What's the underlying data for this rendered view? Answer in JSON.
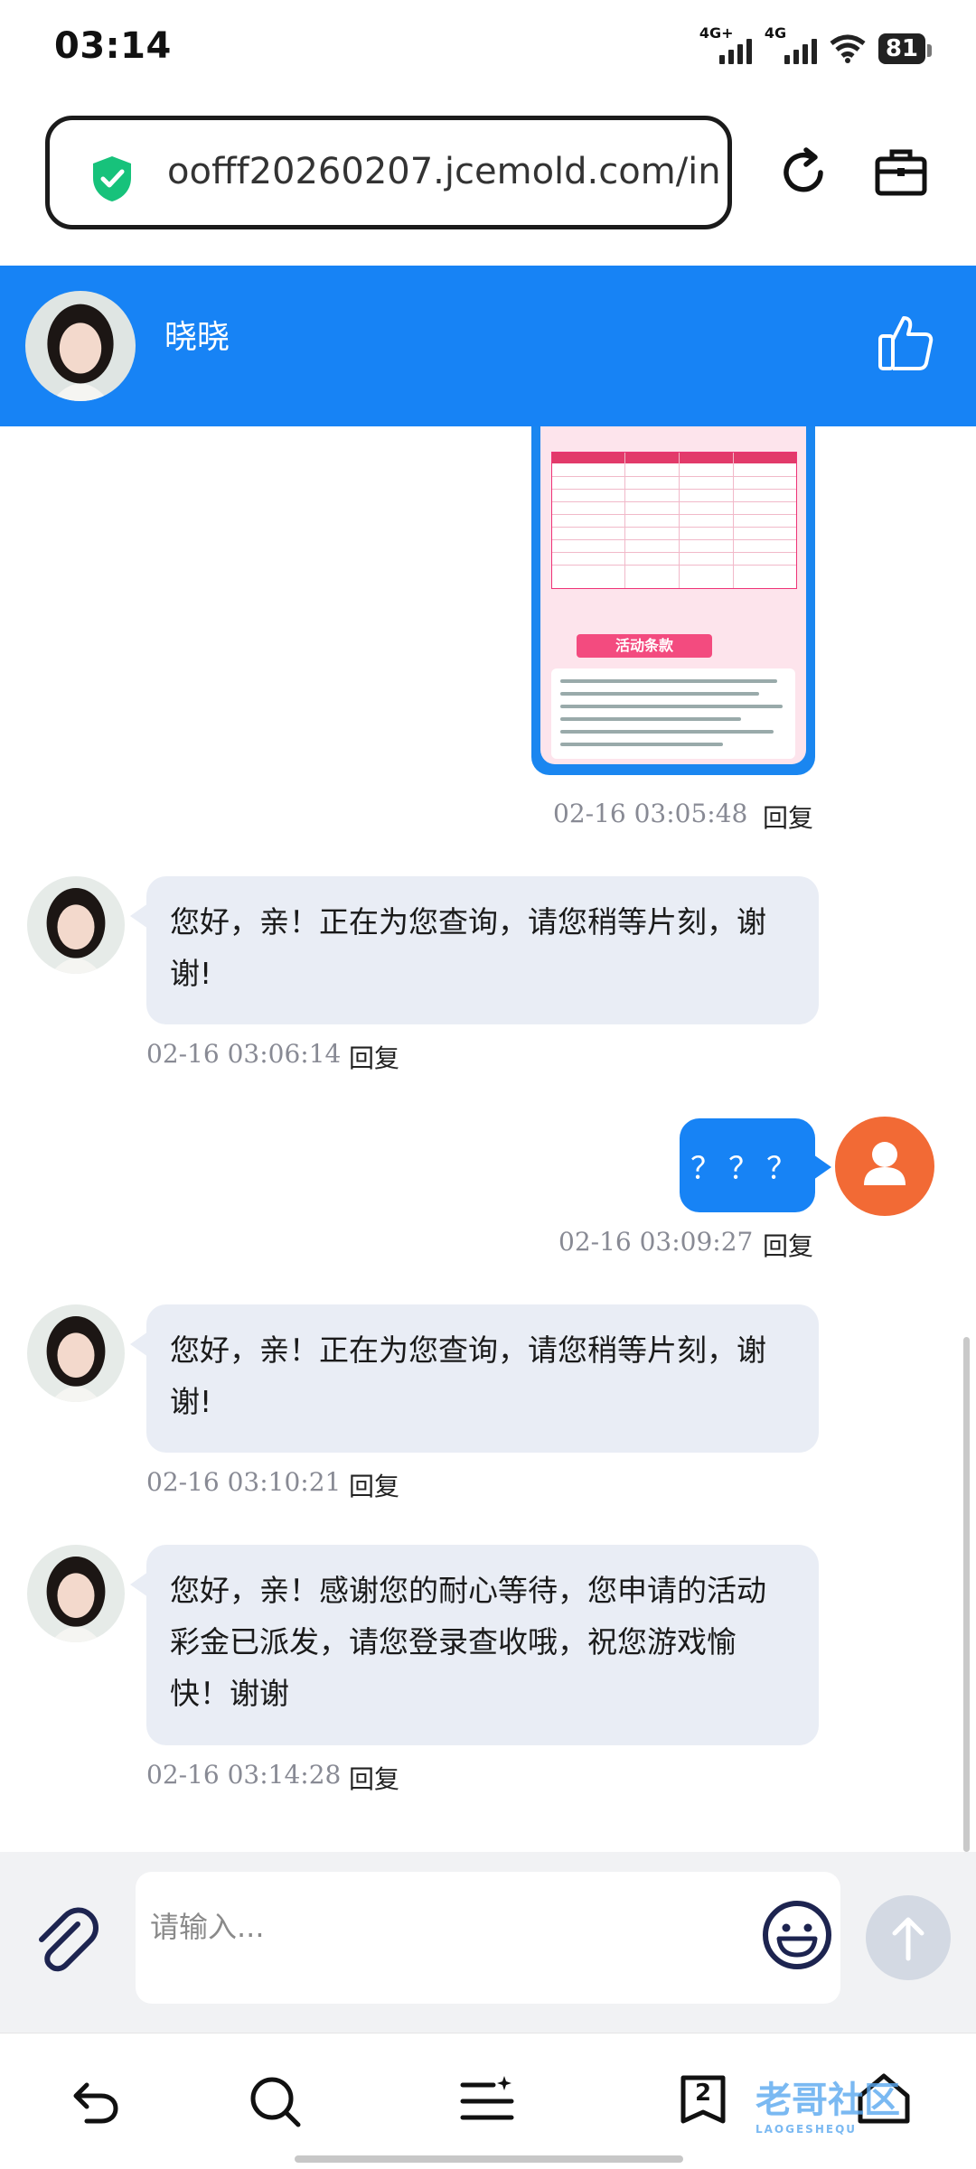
{
  "status_bar": {
    "time": "03:14",
    "net1": "4G+",
    "net2": "4G",
    "battery": "81"
  },
  "browser": {
    "url": "oofff20260207.jcemold.com/in",
    "security_icon": "shield-check-icon",
    "reload_icon": "reload-icon",
    "toolbox_icon": "briefcase-icon"
  },
  "chat": {
    "agent_name": "晓晓",
    "header_action_icon": "thumbs-up-icon",
    "messages": [
      {
        "side": "right",
        "type": "image",
        "time": "02-16 03:05:48",
        "reply": "回复",
        "image_texts": {
          "banner": "活动条款"
        }
      },
      {
        "side": "left",
        "text": "您好，亲！正在为您查询，请您稍等片刻，谢谢!",
        "time": "02-16 03:06:14",
        "reply": "回复"
      },
      {
        "side": "right",
        "text": "？？？",
        "time": "02-16 03:09:27",
        "reply": "回复"
      },
      {
        "side": "left",
        "text": "您好，亲！正在为您查询，请您稍等片刻，谢谢!",
        "time": "02-16 03:10:21",
        "reply": "回复"
      },
      {
        "side": "left",
        "text": "您好，亲！感谢您的耐心等待，您申请的活动彩金已派发，请您登录查收哦，祝您游戏愉快！谢谢",
        "time": "02-16 03:14:28",
        "reply": "回复"
      }
    ]
  },
  "composer": {
    "placeholder": "请输入...",
    "attach_icon": "paperclip-icon",
    "emoji_icon": "smile-icon",
    "send_icon": "arrow-up-icon"
  },
  "bottom_nav": {
    "tab_count": "2",
    "items": [
      "back-icon",
      "search-icon",
      "menu-icon",
      "tabs-icon",
      "home-icon"
    ]
  },
  "watermark": {
    "text": "老哥社区",
    "sub": "LAOGESHEQU"
  },
  "colors": {
    "accent": "#1783f5",
    "bubble_left": "#e9edf5",
    "user_avatar": "#f26a35"
  }
}
